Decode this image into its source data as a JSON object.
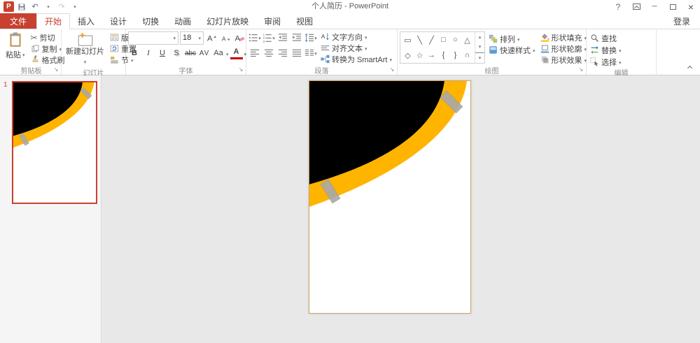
{
  "window": {
    "title": "个人简历 - PowerPoint"
  },
  "tabs": [
    "文件",
    "开始",
    "插入",
    "设计",
    "切换",
    "动画",
    "幻灯片放映",
    "审阅",
    "视图"
  ],
  "signin": "登录",
  "ribbon": {
    "clipboard": {
      "label": "剪贴板",
      "paste": "粘贴",
      "cut": "剪切",
      "copy": "复制",
      "format_painter": "格式刷"
    },
    "slides": {
      "label": "幻灯片",
      "new_slide": "新建幻灯片",
      "layout": "版式",
      "reset": "重置",
      "section": "节"
    },
    "font": {
      "label": "字体",
      "font_name": "",
      "font_size": "18",
      "bold": "B",
      "italic": "I",
      "underline": "U",
      "shadow": "S",
      "strike": "abc",
      "spacing": "AV",
      "case": "Aa",
      "color": "A"
    },
    "paragraph": {
      "label": "段落",
      "text_direction": "文字方向",
      "align_text": "对齐文本",
      "smartart": "转换为 SmartArt"
    },
    "drawing": {
      "label": "绘图",
      "arrange": "排列",
      "quick_styles": "快速样式",
      "shape_fill": "形状填充",
      "shape_outline": "形状轮廓",
      "shape_effects": "形状效果",
      "shapes_row1": [
        "▭",
        "╲",
        "╱",
        "□",
        "○",
        "△"
      ],
      "shapes_row2": [
        "◇",
        "☆",
        "→",
        "{",
        "}",
        "∩"
      ]
    },
    "editing": {
      "label": "编辑",
      "find": "查找",
      "replace": "替换",
      "select": "选择"
    }
  },
  "slides_panel": {
    "slide_number": "1"
  },
  "colors": {
    "accent": "#c8402f",
    "slide_background": "#ffffff",
    "slide_shape": "#000000",
    "slide_band": "#ffb400",
    "tape": "#a9a9a9"
  }
}
